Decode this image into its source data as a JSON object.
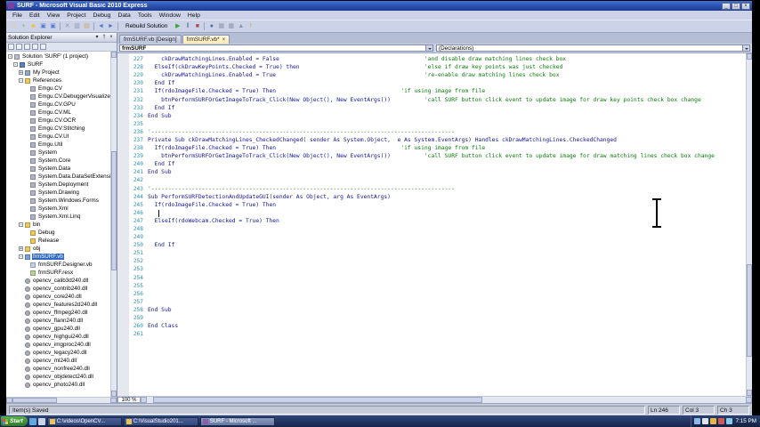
{
  "window": {
    "title": "SURF - Microsoft Visual Basic 2010 Express",
    "buttons": [
      {
        "name": "minimize",
        "glyph": "_"
      },
      {
        "name": "maximize",
        "glyph": "□"
      },
      {
        "name": "close",
        "glyph": "×"
      }
    ]
  },
  "menu": {
    "items": [
      "File",
      "Edit",
      "View",
      "Project",
      "Debug",
      "Data",
      "Tools",
      "Window",
      "Help"
    ]
  },
  "toolbar": {
    "label": "Rebuild Solution",
    "icons": [
      {
        "name": "new-project",
        "glyph": "□",
        "color": "#e8c35a"
      },
      {
        "name": "add-item",
        "glyph": "+",
        "color": "#6fb86f"
      },
      {
        "name": "open-file",
        "glyph": "◆",
        "color": "#e8c35a"
      },
      {
        "name": "save",
        "glyph": "▣",
        "color": "#5b7fd0"
      },
      {
        "name": "save-all",
        "glyph": "▣",
        "color": "#5b7fd0"
      },
      {
        "name": "cut",
        "glyph": "✕",
        "color": "#8a96ad"
      },
      {
        "name": "copy",
        "glyph": "▥",
        "color": "#8a96ad"
      },
      {
        "name": "paste",
        "glyph": "▤",
        "color": "#c8a860"
      },
      {
        "name": "undo",
        "glyph": "◄",
        "color": "#4a78c8"
      },
      {
        "name": "redo",
        "glyph": "►",
        "color": "#4a78c8"
      },
      {
        "name": "run",
        "glyph": "▶",
        "color": "#3aa63a"
      },
      {
        "name": "break-all",
        "glyph": "‖",
        "color": "#4a6a9a"
      },
      {
        "name": "stop",
        "glyph": "■",
        "color": "#b04a4a"
      },
      {
        "name": "find",
        "glyph": "●",
        "color": "#4a6a9a"
      },
      {
        "name": "solution-explorer",
        "glyph": "▦",
        "color": "#8a96ad"
      },
      {
        "name": "properties-window",
        "glyph": "▦",
        "color": "#8a96ad"
      },
      {
        "name": "toolbox",
        "glyph": "▲",
        "color": "#8a96ad"
      },
      {
        "name": "error-list",
        "glyph": "!",
        "color": "#c8a820"
      }
    ]
  },
  "solution_explorer": {
    "title": "Solution Explorer",
    "header_buttons": [
      {
        "name": "window-menu",
        "glyph": "▾"
      },
      {
        "name": "pin",
        "glyph": "†"
      },
      {
        "name": "close",
        "glyph": "×"
      }
    ],
    "tools": [
      "properties",
      "show-all-files",
      "refresh",
      "view-code",
      "view-designer"
    ],
    "items": [
      {
        "label": "Solution 'SURF' (1 project)",
        "level": 0,
        "icon": "solution",
        "exp": "minus"
      },
      {
        "label": "SURF",
        "level": 1,
        "icon": "project",
        "exp": "minus"
      },
      {
        "label": "My Project",
        "level": 2,
        "icon": "myproject",
        "exp": "plus"
      },
      {
        "label": "References",
        "level": 2,
        "icon": "references",
        "exp": "minus"
      },
      {
        "label": "Emgu.CV",
        "level": 3,
        "icon": "reference"
      },
      {
        "label": "Emgu.CV.DebuggerVisualizers",
        "level": 3,
        "icon": "reference"
      },
      {
        "label": "Emgu.CV.GPU",
        "level": 3,
        "icon": "reference"
      },
      {
        "label": "Emgu.CV.ML",
        "level": 3,
        "icon": "reference"
      },
      {
        "label": "Emgu.CV.OCR",
        "level": 3,
        "icon": "reference"
      },
      {
        "label": "Emgu.CV.Stitching",
        "level": 3,
        "icon": "reference"
      },
      {
        "label": "Emgu.CV.UI",
        "level": 3,
        "icon": "reference"
      },
      {
        "label": "Emgu.Util",
        "level": 3,
        "icon": "reference"
      },
      {
        "label": "System",
        "level": 3,
        "icon": "reference"
      },
      {
        "label": "System.Core",
        "level": 3,
        "icon": "reference"
      },
      {
        "label": "System.Data",
        "level": 3,
        "icon": "reference"
      },
      {
        "label": "System.Data.DataSetExtensions",
        "level": 3,
        "icon": "reference"
      },
      {
        "label": "System.Deployment",
        "level": 3,
        "icon": "reference"
      },
      {
        "label": "System.Drawing",
        "level": 3,
        "icon": "reference"
      },
      {
        "label": "System.Windows.Forms",
        "level": 3,
        "icon": "reference"
      },
      {
        "label": "System.Xml",
        "level": 3,
        "icon": "reference"
      },
      {
        "label": "System.Xml.Linq",
        "level": 3,
        "icon": "reference"
      },
      {
        "label": "bin",
        "level": 2,
        "icon": "folder",
        "exp": "minus"
      },
      {
        "label": "Debug",
        "level": 3,
        "icon": "folder"
      },
      {
        "label": "Release",
        "level": 3,
        "icon": "folder"
      },
      {
        "label": "obj",
        "level": 2,
        "icon": "folder",
        "exp": "plus"
      },
      {
        "label": "frmSURF.vb",
        "level": 2,
        "icon": "vbform",
        "exp": "minus",
        "selected": true
      },
      {
        "label": "frmSURF.Designer.vb",
        "level": 3,
        "icon": "vbfile"
      },
      {
        "label": "frmSURF.resx",
        "level": 3,
        "icon": "resx"
      },
      {
        "label": "opencv_calib3d240.dll",
        "level": 2,
        "icon": "dll"
      },
      {
        "label": "opencv_contrib240.dll",
        "level": 2,
        "icon": "dll"
      },
      {
        "label": "opencv_core240.dll",
        "level": 2,
        "icon": "dll"
      },
      {
        "label": "opencv_features2d240.dll",
        "level": 2,
        "icon": "dll"
      },
      {
        "label": "opencv_ffmpeg240.dll",
        "level": 2,
        "icon": "dll"
      },
      {
        "label": "opencv_flann240.dll",
        "level": 2,
        "icon": "dll"
      },
      {
        "label": "opencv_gpu240.dll",
        "level": 2,
        "icon": "dll"
      },
      {
        "label": "opencv_highgui240.dll",
        "level": 2,
        "icon": "dll"
      },
      {
        "label": "opencv_imgproc240.dll",
        "level": 2,
        "icon": "dll"
      },
      {
        "label": "opencv_legacy240.dll",
        "level": 2,
        "icon": "dll"
      },
      {
        "label": "opencv_ml240.dll",
        "level": 2,
        "icon": "dll"
      },
      {
        "label": "opencv_nonfree240.dll",
        "level": 2,
        "icon": "dll"
      },
      {
        "label": "opencv_objdetect240.dll",
        "level": 2,
        "icon": "dll"
      },
      {
        "label": "opencv_photo240.dll",
        "level": 2,
        "icon": "dll"
      }
    ]
  },
  "editor": {
    "tabs": [
      {
        "label": "frmSURF.vb [Design]",
        "active": false
      },
      {
        "label": "frmSURF.vb*",
        "active": true
      }
    ],
    "tab_close": "×",
    "object_list": "frmSURF",
    "member_list": "(Declarations)",
    "zoom": "100 %",
    "lines": [
      {
        "n": 227,
        "code": "    ckDrawMatchingLines.Enabled = False",
        "comment": "'and disable draw matching lines check box",
        "ccol": 82
      },
      {
        "n": 228,
        "code": "  ElseIf(ckDrawKeyPoints.Checked = True) then",
        "comment": "'else if draw key points was just checked",
        "ccol": 82
      },
      {
        "n": 229,
        "code": "    ckDrawMatchingLines.Enabled = True",
        "comment": "'re-enable draw matching lines check box",
        "ccol": 82
      },
      {
        "n": 230,
        "code": "  End If"
      },
      {
        "n": 231,
        "code": "  If(rdoImageFile.Checked = True) Then",
        "comment": "'if using image from file",
        "ccol": 75
      },
      {
        "n": 232,
        "code": "    btnPerformSURFOrGetImageToTrack_Click(New Object(), New EventArgs())",
        "comment": "'call SURF button click event to update image for draw key points check box change",
        "ccol": 82
      },
      {
        "n": 233,
        "code": "  End If"
      },
      {
        "n": 234,
        "code": "End Sub"
      },
      {
        "n": 235,
        "code": ""
      },
      {
        "n": 236,
        "code": "",
        "comment": "'------------------------------------------------------------------------------------------",
        "ccol": 0
      },
      {
        "n": 237,
        "code": "Private Sub ckDrawMatchingLines_CheckedChanged( sender As System.Object,  e As System.EventArgs) Handles ckDrawMatchingLines.CheckedChanged"
      },
      {
        "n": 238,
        "code": "  If(rdoImageFile.Checked = True) Then",
        "comment": "'if using image from file",
        "ccol": 75
      },
      {
        "n": 239,
        "code": "    btnPerformSURFOrGetImageToTrack_Click(New Object(), New EventArgs())",
        "comment": "'call SURF button click event to update image for draw matching lines check box change",
        "ccol": 82
      },
      {
        "n": 240,
        "code": "  End If"
      },
      {
        "n": 241,
        "code": "End Sub"
      },
      {
        "n": 242,
        "code": ""
      },
      {
        "n": 243,
        "code": "",
        "comment": "'------------------------------------------------------------------------------------------",
        "ccol": 0
      },
      {
        "n": 244,
        "code": "Sub PerformSURFDetectionAndUpdateGUI(sender As Object, arg As EventArgs)"
      },
      {
        "n": 245,
        "code": "  If(rdoImageFile.Checked = True) Then"
      },
      {
        "n": 246,
        "code": ""
      },
      {
        "n": 247,
        "code": "  ElseIf(rdoWebcam.Checked = True) Then"
      },
      {
        "n": 248,
        "code": ""
      },
      {
        "n": 249,
        "code": ""
      },
      {
        "n": 250,
        "code": "  End If"
      },
      {
        "n": 251,
        "code": ""
      },
      {
        "n": 252,
        "code": ""
      },
      {
        "n": 253,
        "code": ""
      },
      {
        "n": 254,
        "code": ""
      },
      {
        "n": 255,
        "code": ""
      },
      {
        "n": 256,
        "code": ""
      },
      {
        "n": 257,
        "code": ""
      },
      {
        "n": 258,
        "code": "End Sub"
      },
      {
        "n": 259,
        "code": ""
      },
      {
        "n": 260,
        "code": "End Class"
      },
      {
        "n": 261,
        "code": ""
      }
    ]
  },
  "status_bar": {
    "message": "Item(s) Saved",
    "ln": "Ln 246",
    "col": "Col 3",
    "ch": "Ch 3"
  },
  "taskbar": {
    "start_label": "Start",
    "quick_launch": [
      {
        "name": "internet-explorer",
        "color": "#5fa8e0"
      },
      {
        "name": "show-desktop",
        "color": "#c8d4e8"
      }
    ],
    "buttons": [
      {
        "label": "C:\\videos\\OpenCV...",
        "active": false,
        "icon": "folder",
        "icon_color": "#e8c35a"
      },
      {
        "label": "C:\\VisualStudio201...",
        "active": false,
        "icon": "folder",
        "icon_color": "#e8c35a"
      },
      {
        "label": "SURF - Microsoft ...",
        "active": true,
        "icon": "visual-studio",
        "icon_color": "#8a5fa8"
      }
    ],
    "tray_icons": [
      {
        "name": "tray-icon-1",
        "color": "#8fb8e8"
      },
      {
        "name": "tray-icon-2",
        "color": "#e0e4ee"
      },
      {
        "name": "tray-icon-3",
        "color": "#e8b44a"
      },
      {
        "name": "tray-icon-4",
        "color": "#d05858"
      },
      {
        "name": "tray-icon-5",
        "color": "#88c8e8"
      }
    ],
    "clock": "7:15 PM"
  },
  "colors": {
    "code_text": "#16169c",
    "comment": "#0a7d0a",
    "line_number": "#2b91af",
    "selection": "#316ac5",
    "active_tab": "#ffe9a8"
  }
}
